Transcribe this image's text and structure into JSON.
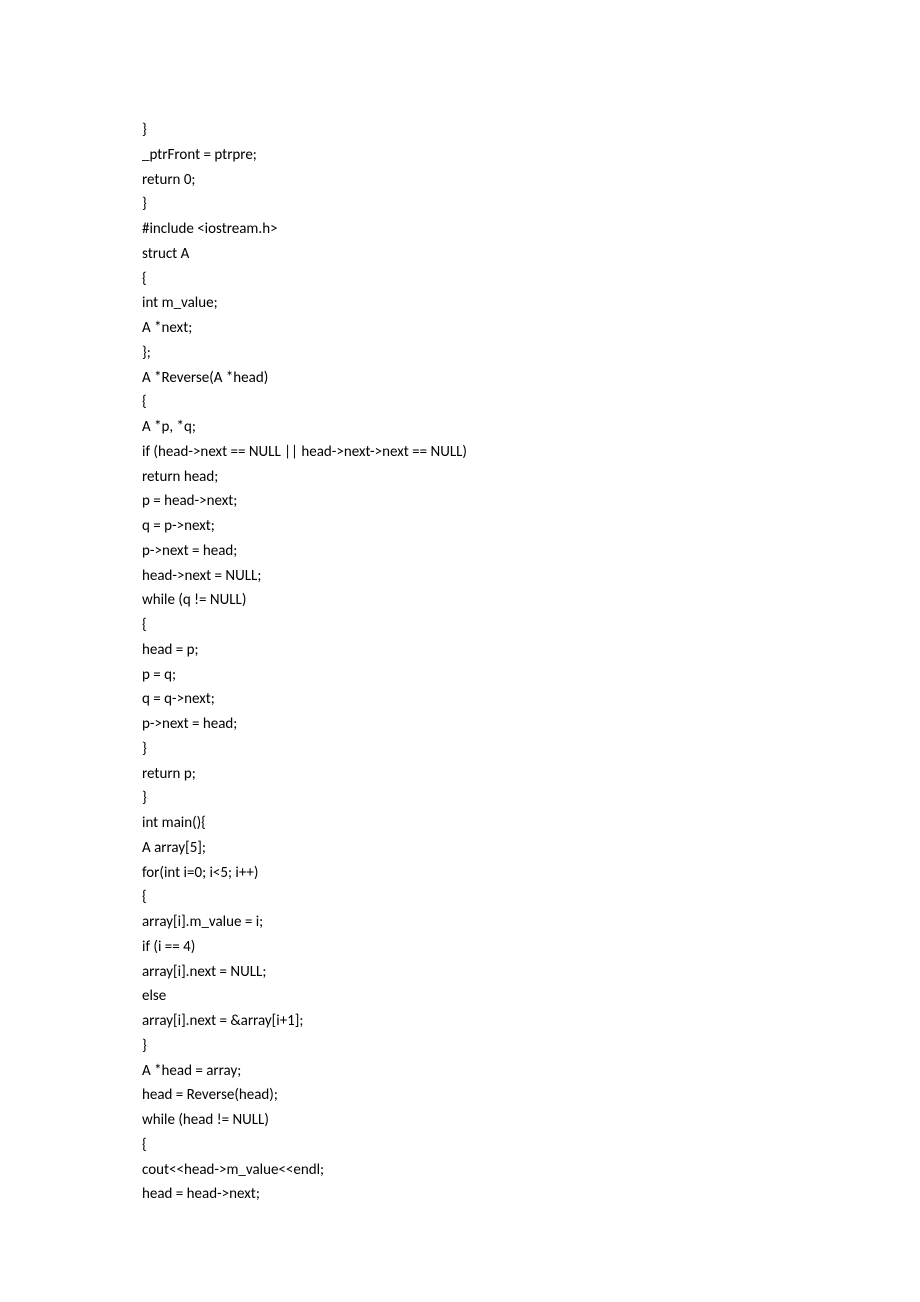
{
  "code_lines": [
    "}",
    "_ptrFront = ptrpre;",
    "return 0;",
    "}",
    "#include <iostream.h>",
    "struct A",
    "{",
    "int m_value;",
    "A *next;",
    "};",
    "A *Reverse(A *head)",
    "{",
    "A *p, *q;",
    "if (head->next == NULL || head->next->next == NULL)",
    "return head;",
    "p = head->next;",
    "q = p->next;",
    "p->next = head;",
    "head->next = NULL;",
    "while (q != NULL)",
    "{",
    "head = p;",
    "p = q;",
    "q = q->next;",
    "p->next = head;",
    "}",
    "return p;",
    "}",
    "int main(){",
    "A array[5];",
    "for(int i=0; i<5; i++)",
    "{",
    "array[i].m_value = i;",
    "if (i == 4)",
    "array[i].next = NULL;",
    "else",
    "array[i].next = &array[i+1];",
    "}",
    "A *head = array;",
    "head = Reverse(head);",
    "while (head != NULL)",
    "{",
    "cout<<head->m_value<<endl;",
    "head = head->next;"
  ]
}
